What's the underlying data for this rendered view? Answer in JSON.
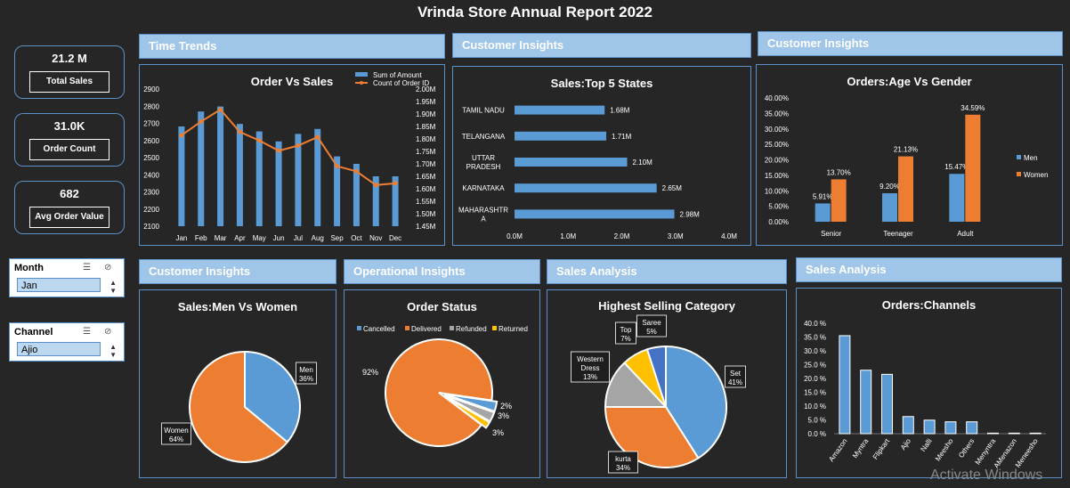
{
  "title": "Vrinda Store Annual Report 2022",
  "kpis": [
    {
      "value": "21.2 M",
      "label": "Total Sales"
    },
    {
      "value": "31.0K",
      "label": "Order Count"
    },
    {
      "value": "682",
      "label": "Avg Order Value"
    }
  ],
  "headers": {
    "time": "Time Trends",
    "cust1": "Customer Insights",
    "cust2": "Customer Insights",
    "cust3": "Customer Insights",
    "ops": "Operational Insights",
    "sales1": "Sales Analysis",
    "sales2": "Sales Analysis"
  },
  "slicers": [
    {
      "title": "Month",
      "selected": "Jan"
    },
    {
      "title": "Channel",
      "selected": "Ajio"
    }
  ],
  "watermark": "Activate Windows",
  "chart_data": [
    {
      "type": "bar",
      "title": "Order Vs Sales",
      "categories": [
        "Jan",
        "Feb",
        "Mar",
        "Apr",
        "May",
        "Jun",
        "Jul",
        "Aug",
        "Sep",
        "Oct",
        "Nov",
        "Dec"
      ],
      "series": [
        {
          "name": "Sum of Amount",
          "type": "bar",
          "axis": "left",
          "values": [
            1.85,
            1.91,
            1.93,
            1.86,
            1.83,
            1.79,
            1.82,
            1.84,
            1.73,
            1.7,
            1.65,
            1.65
          ],
          "color": "#5b9bd5"
        },
        {
          "name": "Count of Order ID",
          "type": "line",
          "axis": "right",
          "values": [
            2630,
            2710,
            2780,
            2650,
            2600,
            2540,
            2570,
            2620,
            2450,
            2420,
            2340,
            2350
          ],
          "color": "#ed7d31"
        }
      ],
      "y_left": {
        "ticks": [
          "2100",
          "2200",
          "2300",
          "2400",
          "2500",
          "2600",
          "2700",
          "2800",
          "2900"
        ],
        "min": 2100,
        "max": 2900
      },
      "y_right": {
        "ticks": [
          "1.45M",
          "1.50M",
          "1.55M",
          "1.60M",
          "1.65M",
          "1.70M",
          "1.75M",
          "1.80M",
          "1.85M",
          "1.90M",
          "1.95M",
          "2.00M"
        ],
        "min": 1.45,
        "max": 2.0
      }
    },
    {
      "type": "bar",
      "orientation": "horizontal",
      "title": "Sales:Top 5 States",
      "categories": [
        "TAMIL NADU",
        "TELANGANA",
        "UTTAR PRADESH",
        "KARNATAKA",
        "MAHARASHTRA"
      ],
      "cat_lines": [
        [
          "TAMIL NADU"
        ],
        [
          "TELANGANA"
        ],
        [
          "UTTAR",
          "PRADESH"
        ],
        [
          "KARNATAKA"
        ],
        [
          "MAHARASHTR",
          "A"
        ]
      ],
      "values": [
        1.68,
        1.71,
        2.1,
        2.65,
        2.98
      ],
      "labels": [
        "1.68M",
        "1.71M",
        "2.10M",
        "2.65M",
        "2.98M"
      ],
      "xlim": [
        0,
        4
      ],
      "x_ticks": [
        "0.0M",
        "1.0M",
        "2.0M",
        "3.0M",
        "4.0M"
      ]
    },
    {
      "type": "bar",
      "title": "Orders:Age Vs Gender",
      "categories": [
        "Senior",
        "Teenager",
        "Adult"
      ],
      "series": [
        {
          "name": "Men",
          "values": [
            5.91,
            9.2,
            15.47
          ],
          "labels": [
            "5.91%",
            "9.20%",
            "15.47%"
          ],
          "color": "#5b9bd5"
        },
        {
          "name": "Women",
          "values": [
            13.7,
            21.13,
            34.59
          ],
          "labels": [
            "13.70%",
            "21.13%",
            "34.59%"
          ],
          "color": "#ed7d31"
        }
      ],
      "ylim": [
        0,
        40
      ],
      "y_ticks": [
        "0.00%",
        "5.00%",
        "10.00%",
        "15.00%",
        "20.00%",
        "25.00%",
        "30.00%",
        "35.00%",
        "40.00%"
      ],
      "legend": "right"
    },
    {
      "type": "pie",
      "title": "Sales:Men Vs Women",
      "slices": [
        {
          "name": "Men",
          "value": 36,
          "label": "36%",
          "color": "#5b9bd5"
        },
        {
          "name": "Women",
          "value": 64,
          "label": "64%",
          "color": "#ed7d31"
        }
      ]
    },
    {
      "type": "pie",
      "title": "Order Status",
      "legend_items": [
        "Cancelled",
        "Delivered",
        "Refunded",
        "Returned"
      ],
      "slices": [
        {
          "name": "Delivered",
          "value": 92,
          "label": "92%",
          "color": "#ed7d31"
        },
        {
          "name": "Cancelled",
          "value": 3,
          "label": "3%",
          "color": "#5b9bd5"
        },
        {
          "name": "Refunded",
          "value": 3,
          "label": "3%",
          "color": "#a5a5a5"
        },
        {
          "name": "Returned",
          "value": 2,
          "label": "2%",
          "color": "#ffc000"
        }
      ],
      "legend": "top"
    },
    {
      "type": "pie",
      "title": "Highest Selling Category",
      "slices": [
        {
          "name": "Set",
          "value": 41,
          "label": "41%",
          "color": "#5b9bd5"
        },
        {
          "name": "kurta",
          "value": 34,
          "label": "34%",
          "color": "#ed7d31"
        },
        {
          "name": "Western Dress",
          "value": 13,
          "label": "13%",
          "color": "#a5a5a5"
        },
        {
          "name": "Top",
          "value": 7,
          "label": "7%",
          "color": "#ffc000"
        },
        {
          "name": "Saree",
          "value": 5,
          "label": "5%",
          "color": "#4472c4"
        }
      ]
    },
    {
      "type": "bar",
      "title": "Orders:Channels",
      "categories": [
        "Amazon",
        "Myntra",
        "Flipkart",
        "Ajio",
        "Nalli",
        "Meesho",
        "Others",
        "Menyntra",
        "AMenazon",
        "Meneesho"
      ],
      "values": [
        35.5,
        23.0,
        21.5,
        6.2,
        4.9,
        4.3,
        4.3,
        0.2,
        0.2,
        0.2
      ],
      "ylim": [
        0,
        40
      ],
      "y_ticks": [
        "0.0 %",
        "5.0 %",
        "10.0 %",
        "15.0 %",
        "20.0 %",
        "25.0 %",
        "30.0 %",
        "35.0 %",
        "40.0 %"
      ]
    }
  ]
}
